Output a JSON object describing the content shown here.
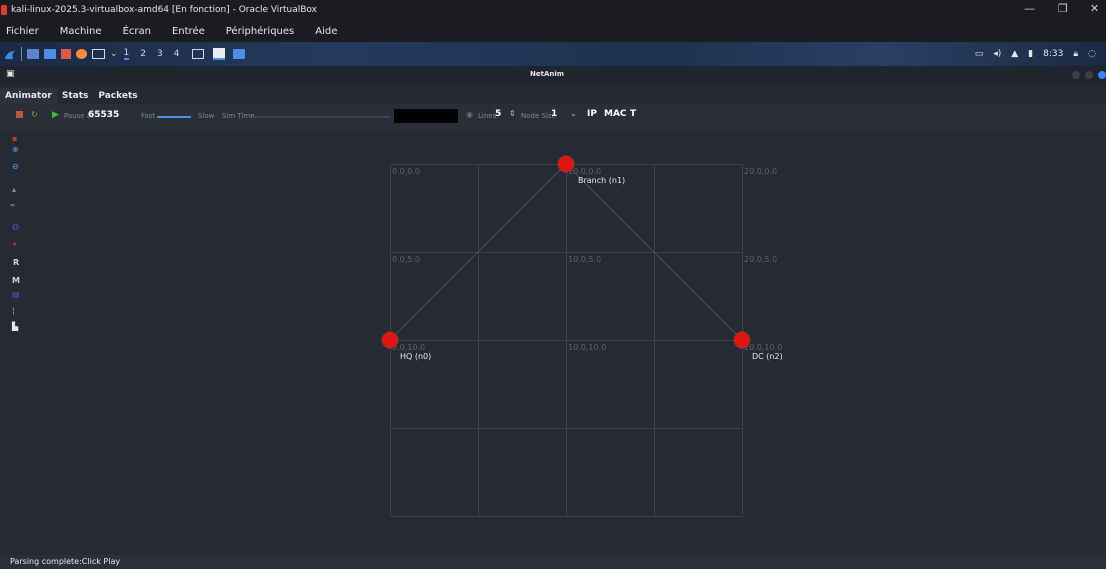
{
  "vbox": {
    "window_title": "kali-linux-2025.3-virtualbox-amd64 [En fonction] - Oracle VirtualBox",
    "controls": {
      "minimize": "—",
      "maximize": "❐",
      "close": "✕"
    },
    "menu": [
      "Fichier",
      "Machine",
      "Écran",
      "Entrée",
      "Périphériques",
      "Aide"
    ]
  },
  "kali_panel": {
    "workspaces": [
      "1",
      "2",
      "3",
      "4"
    ],
    "clock": "8:33"
  },
  "app": {
    "title": "NetAnim",
    "tabs": [
      "Animator",
      "Stats",
      "Packets"
    ],
    "toolbar": {
      "pause_label": "Pause at",
      "pause_value": "65535",
      "fast_label": "Fast",
      "slow_label": "Slow",
      "sim_time_label": "Sim Time",
      "lines_label": "Lines",
      "lines_value": "5",
      "node_size_label": "Node Size",
      "node_size_value": "1",
      "ip_label": "IP",
      "mac_label": "MAC",
      "t_label": "T"
    },
    "left_tools": [
      "R",
      "M"
    ],
    "grid": {
      "labels": [
        "0.0,0.0",
        "10.0,0.0",
        "20.0,0.0",
        "0.0,5.0",
        "10.0,5.0",
        "20.0,5.0",
        "0.0,10.0",
        "10.0,10.0",
        "20.0,10.0"
      ]
    },
    "nodes": [
      {
        "label": "HQ (n0)",
        "x": 0,
        "y": 10
      },
      {
        "label": "Branch (n1)",
        "x": 10,
        "y": 0
      },
      {
        "label": "DC (n2)",
        "x": 20,
        "y": 10
      }
    ],
    "status": "Parsing complete:Click Play"
  },
  "colors": {
    "node": "#e11414",
    "accent": "#4f8ee8",
    "background": "#262a33"
  }
}
